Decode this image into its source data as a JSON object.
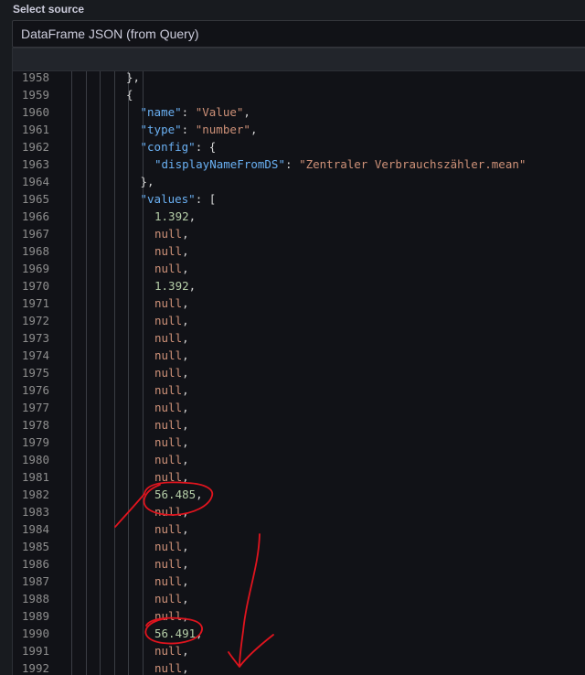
{
  "source": {
    "label": "Select source",
    "selected": "DataFrame JSON (from Query)"
  },
  "editor": {
    "lines": [
      {
        "n": "1958",
        "indent": 8,
        "tokens": [
          {
            "t": "},",
            "c": "p"
          }
        ]
      },
      {
        "n": "1959",
        "indent": 8,
        "tokens": [
          {
            "t": "{",
            "c": "p"
          }
        ]
      },
      {
        "n": "1960",
        "indent": 10,
        "tokens": [
          {
            "t": "\"name\"",
            "c": "k"
          },
          {
            "t": ": ",
            "c": "p"
          },
          {
            "t": "\"Value\"",
            "c": "s"
          },
          {
            "t": ",",
            "c": "p"
          }
        ]
      },
      {
        "n": "1961",
        "indent": 10,
        "tokens": [
          {
            "t": "\"type\"",
            "c": "k"
          },
          {
            "t": ": ",
            "c": "p"
          },
          {
            "t": "\"number\"",
            "c": "s"
          },
          {
            "t": ",",
            "c": "p"
          }
        ]
      },
      {
        "n": "1962",
        "indent": 10,
        "tokens": [
          {
            "t": "\"config\"",
            "c": "k"
          },
          {
            "t": ": {",
            "c": "p"
          }
        ]
      },
      {
        "n": "1963",
        "indent": 12,
        "tokens": [
          {
            "t": "\"displayNameFromDS\"",
            "c": "k"
          },
          {
            "t": ": ",
            "c": "p"
          },
          {
            "t": "\"Zentraler Verbrauchszähler.mean\"",
            "c": "s"
          }
        ]
      },
      {
        "n": "1964",
        "indent": 10,
        "tokens": [
          {
            "t": "},",
            "c": "p"
          }
        ]
      },
      {
        "n": "1965",
        "indent": 10,
        "tokens": [
          {
            "t": "\"values\"",
            "c": "k"
          },
          {
            "t": ": [",
            "c": "p"
          }
        ]
      },
      {
        "n": "1966",
        "indent": 12,
        "tokens": [
          {
            "t": "1.392",
            "c": "n"
          },
          {
            "t": ",",
            "c": "p"
          }
        ]
      },
      {
        "n": "1967",
        "indent": 12,
        "tokens": [
          {
            "t": "null",
            "c": "nl"
          },
          {
            "t": ",",
            "c": "p"
          }
        ]
      },
      {
        "n": "1968",
        "indent": 12,
        "tokens": [
          {
            "t": "null",
            "c": "nl"
          },
          {
            "t": ",",
            "c": "p"
          }
        ]
      },
      {
        "n": "1969",
        "indent": 12,
        "tokens": [
          {
            "t": "null",
            "c": "nl"
          },
          {
            "t": ",",
            "c": "p"
          }
        ]
      },
      {
        "n": "1970",
        "indent": 12,
        "tokens": [
          {
            "t": "1.392",
            "c": "n"
          },
          {
            "t": ",",
            "c": "p"
          }
        ]
      },
      {
        "n": "1971",
        "indent": 12,
        "tokens": [
          {
            "t": "null",
            "c": "nl"
          },
          {
            "t": ",",
            "c": "p"
          }
        ]
      },
      {
        "n": "1972",
        "indent": 12,
        "tokens": [
          {
            "t": "null",
            "c": "nl"
          },
          {
            "t": ",",
            "c": "p"
          }
        ]
      },
      {
        "n": "1973",
        "indent": 12,
        "tokens": [
          {
            "t": "null",
            "c": "nl"
          },
          {
            "t": ",",
            "c": "p"
          }
        ]
      },
      {
        "n": "1974",
        "indent": 12,
        "tokens": [
          {
            "t": "null",
            "c": "nl"
          },
          {
            "t": ",",
            "c": "p"
          }
        ]
      },
      {
        "n": "1975",
        "indent": 12,
        "tokens": [
          {
            "t": "null",
            "c": "nl"
          },
          {
            "t": ",",
            "c": "p"
          }
        ]
      },
      {
        "n": "1976",
        "indent": 12,
        "tokens": [
          {
            "t": "null",
            "c": "nl"
          },
          {
            "t": ",",
            "c": "p"
          }
        ]
      },
      {
        "n": "1977",
        "indent": 12,
        "tokens": [
          {
            "t": "null",
            "c": "nl"
          },
          {
            "t": ",",
            "c": "p"
          }
        ]
      },
      {
        "n": "1978",
        "indent": 12,
        "tokens": [
          {
            "t": "null",
            "c": "nl"
          },
          {
            "t": ",",
            "c": "p"
          }
        ]
      },
      {
        "n": "1979",
        "indent": 12,
        "tokens": [
          {
            "t": "null",
            "c": "nl"
          },
          {
            "t": ",",
            "c": "p"
          }
        ]
      },
      {
        "n": "1980",
        "indent": 12,
        "tokens": [
          {
            "t": "null",
            "c": "nl"
          },
          {
            "t": ",",
            "c": "p"
          }
        ]
      },
      {
        "n": "1981",
        "indent": 12,
        "tokens": [
          {
            "t": "null",
            "c": "nl"
          },
          {
            "t": ",",
            "c": "p"
          }
        ]
      },
      {
        "n": "1982",
        "indent": 12,
        "tokens": [
          {
            "t": "56.485",
            "c": "n"
          },
          {
            "t": ",",
            "c": "p"
          }
        ]
      },
      {
        "n": "1983",
        "indent": 12,
        "tokens": [
          {
            "t": "null",
            "c": "nl"
          },
          {
            "t": ",",
            "c": "p"
          }
        ]
      },
      {
        "n": "1984",
        "indent": 12,
        "tokens": [
          {
            "t": "null",
            "c": "nl"
          },
          {
            "t": ",",
            "c": "p"
          }
        ]
      },
      {
        "n": "1985",
        "indent": 12,
        "tokens": [
          {
            "t": "null",
            "c": "nl"
          },
          {
            "t": ",",
            "c": "p"
          }
        ]
      },
      {
        "n": "1986",
        "indent": 12,
        "tokens": [
          {
            "t": "null",
            "c": "nl"
          },
          {
            "t": ",",
            "c": "p"
          }
        ]
      },
      {
        "n": "1987",
        "indent": 12,
        "tokens": [
          {
            "t": "null",
            "c": "nl"
          },
          {
            "t": ",",
            "c": "p"
          }
        ]
      },
      {
        "n": "1988",
        "indent": 12,
        "tokens": [
          {
            "t": "null",
            "c": "nl"
          },
          {
            "t": ",",
            "c": "p"
          }
        ]
      },
      {
        "n": "1989",
        "indent": 12,
        "tokens": [
          {
            "t": "null",
            "c": "nl"
          },
          {
            "t": ",",
            "c": "p"
          }
        ]
      },
      {
        "n": "1990",
        "indent": 12,
        "tokens": [
          {
            "t": "56.491",
            "c": "n"
          },
          {
            "t": ",",
            "c": "p"
          }
        ]
      },
      {
        "n": "1991",
        "indent": 12,
        "tokens": [
          {
            "t": "null",
            "c": "nl"
          },
          {
            "t": ",",
            "c": "p"
          }
        ]
      },
      {
        "n": "1992",
        "indent": 12,
        "tokens": [
          {
            "t": "null",
            "c": "nl"
          },
          {
            "t": ",",
            "c": "p"
          }
        ]
      }
    ]
  },
  "annotation": {
    "color": "#e0141e"
  }
}
